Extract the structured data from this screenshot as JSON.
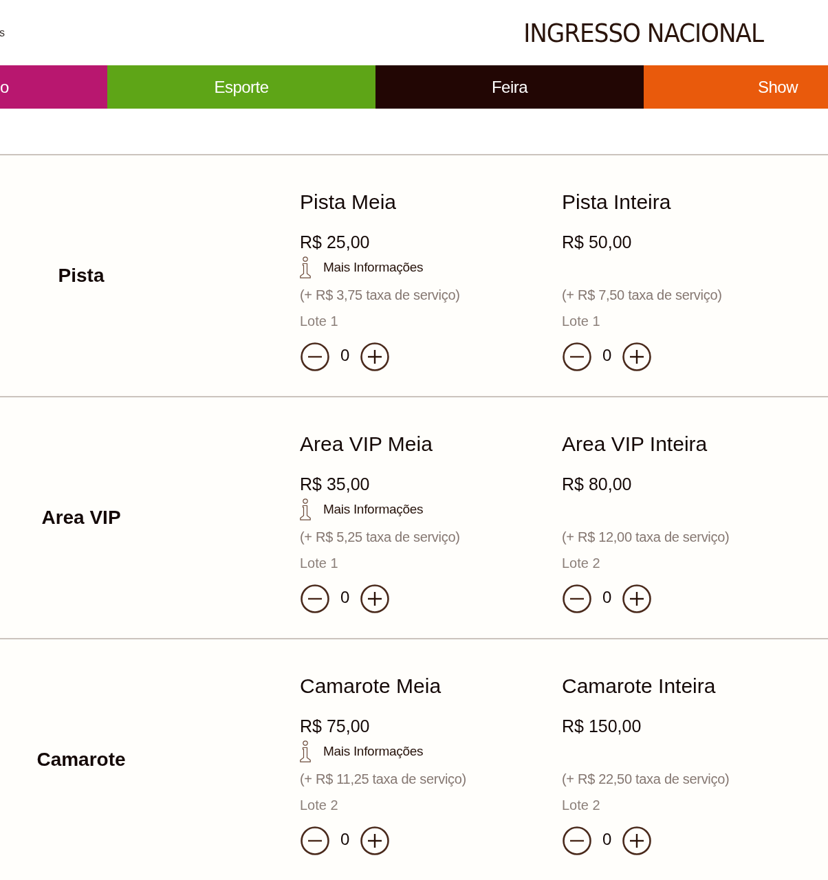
{
  "header": {
    "text": "s",
    "logo": "INGRESSO NACIONAL"
  },
  "nav": [
    {
      "label": "o",
      "color": "#b8176f"
    },
    {
      "label": "Esporte",
      "color": "#5ea517"
    },
    {
      "label": "Feira",
      "color": "#220604"
    },
    {
      "label": "Show",
      "color": "#e95a0c"
    }
  ],
  "sections": [
    {
      "name": "Pista",
      "tickets": [
        {
          "title": "Pista Meia",
          "price": "R$ 25,00",
          "info_link": "Mais Informações",
          "fee": "(+ R$ 3,75 taxa de serviço)",
          "batch": "Lote 1",
          "quantity": "0"
        },
        {
          "title": "Pista Inteira",
          "price": "R$ 50,00",
          "fee": "(+ R$ 7,50 taxa de serviço)",
          "batch": "Lote 1",
          "quantity": "0"
        }
      ]
    },
    {
      "name": "Area VIP",
      "tickets": [
        {
          "title": "Area VIP Meia",
          "price": "R$ 35,00",
          "info_link": "Mais Informações",
          "fee": "(+ R$ 5,25 taxa de serviço)",
          "batch": "Lote 1",
          "quantity": "0"
        },
        {
          "title": "Area VIP Inteira",
          "price": "R$ 80,00",
          "fee": "(+ R$ 12,00 taxa de serviço)",
          "batch": "Lote 2",
          "quantity": "0"
        }
      ]
    },
    {
      "name": "Camarote",
      "tickets": [
        {
          "title": "Camarote Meia",
          "price": "R$ 75,00",
          "info_link": "Mais Informações",
          "fee": "(+ R$ 11,25 taxa de serviço)",
          "batch": "Lote 2",
          "quantity": "0"
        },
        {
          "title": "Camarote Inteira",
          "price": "R$ 150,00",
          "fee": "(+ R$ 22,50 taxa de serviço)",
          "batch": "Lote 2",
          "quantity": "0"
        }
      ]
    }
  ]
}
